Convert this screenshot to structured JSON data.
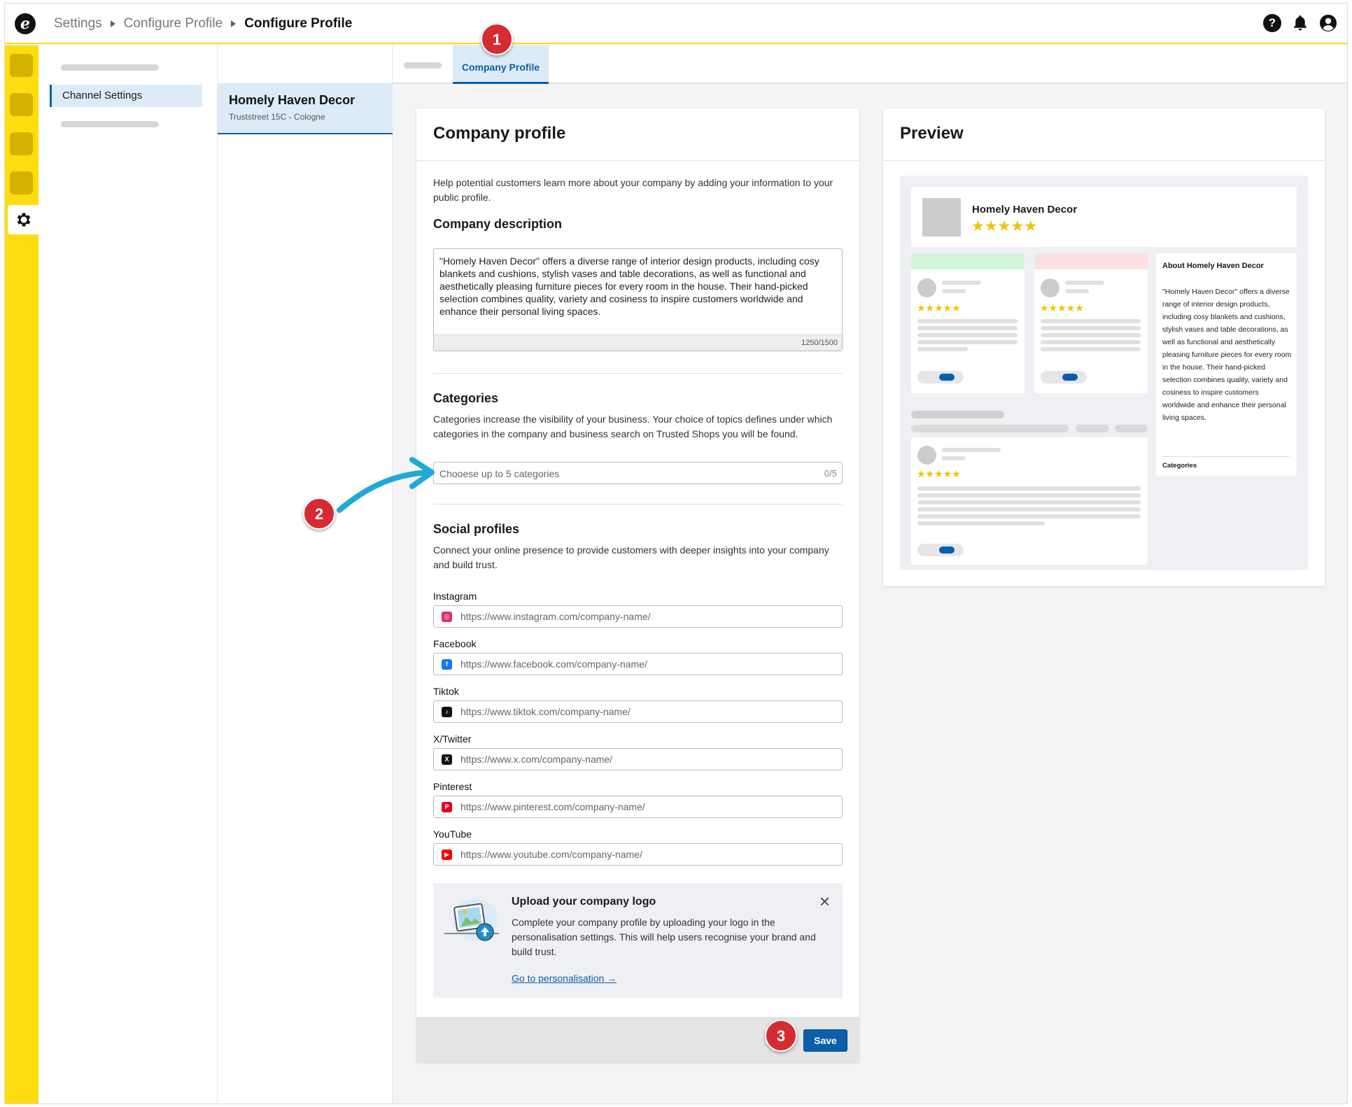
{
  "topbar": {
    "logo_glyph": "e",
    "breadcrumb": [
      "Settings",
      "Configure Profile",
      "Configure Profile"
    ],
    "icons": [
      "help-icon",
      "bell-icon",
      "account-icon"
    ]
  },
  "nav": {
    "active_item": "Channel Settings"
  },
  "shop": {
    "name": "Homely Haven Decor",
    "address": "Truststreet 15C - Cologne"
  },
  "tabs": {
    "active": "Company Profile"
  },
  "company_profile": {
    "title": "Company profile",
    "intro": "Help potential customers learn more about your company by adding your information to your public profile.",
    "description": {
      "heading": "Company description",
      "value": "\"Homely Haven Decor\" offers a diverse range of interior design products, including cosy blankets and cushions, stylish vases and table decorations, as well as functional and aesthetically pleasing furniture pieces for every room in the house. Their hand-picked selection combines quality, variety and cosiness to inspire customers worldwide and enhance their personal living spaces.",
      "counter": "1250/1500"
    },
    "categories": {
      "heading": "Categories",
      "text": "Categories increase the visibility of your business. Your choice of topics defines under which categories in the company and business search on Trusted Shops you will be found.",
      "placeholder": "Chooese up to 5 categories",
      "counter": "0/5"
    },
    "social": {
      "heading": "Social profiles",
      "text": "Connect your online presence to provide customers with deeper insights into your company and build trust.",
      "fields": [
        {
          "label": "Instagram",
          "placeholder": "https://www.instagram.com/company-name/",
          "icon": "instagram-icon",
          "color": "#e1306c"
        },
        {
          "label": "Facebook",
          "placeholder": "https://www.facebook.com/company-name/",
          "icon": "facebook-icon",
          "color": "#1877f2"
        },
        {
          "label": "Tiktok",
          "placeholder": "https://www.tiktok.com/company-name/",
          "icon": "tiktok-icon",
          "color": "#111111"
        },
        {
          "label": "X/Twitter",
          "placeholder": "https://www.x.com/company-name/",
          "icon": "x-icon",
          "color": "#111111"
        },
        {
          "label": "Pinterest",
          "placeholder": "https://www.pinterest.com/company-name/",
          "icon": "pinterest-icon",
          "color": "#e60023"
        },
        {
          "label": "YouTube",
          "placeholder": "https://www.youtube.com/company-name/",
          "icon": "youtube-icon",
          "color": "#ff0000"
        }
      ]
    },
    "logo_banner": {
      "title": "Upload your company logo",
      "text": "Complete your company profile by uploading your logo in the personalisation settings. This will help users recognise your brand and build trust.",
      "link": "Go to personalisation"
    },
    "save_label": "Save"
  },
  "preview": {
    "title": "Preview",
    "shop_name": "Homely Haven Decor",
    "stars": "★★★★★",
    "about_title": "About Homely Haven Decor",
    "about_text": "\"Homely Haven Decor\" offers a diverse range of interior design products, including cosy blankets and cushions, stylish vases and table decorations, as well as functional and aesthetically pleasing furniture pieces for every room in the house. Their hand-picked selection combines quality, variety and cosiness to inspire customers worldwide and enhance their personal living spaces.",
    "categories_label": "Categories"
  },
  "annotations": [
    "1",
    "2",
    "3"
  ],
  "colors": {
    "accent": "#0b5ea8",
    "rail": "#ffdc0f",
    "annotation": "#d52b32",
    "arrow": "#1fa9d6"
  }
}
